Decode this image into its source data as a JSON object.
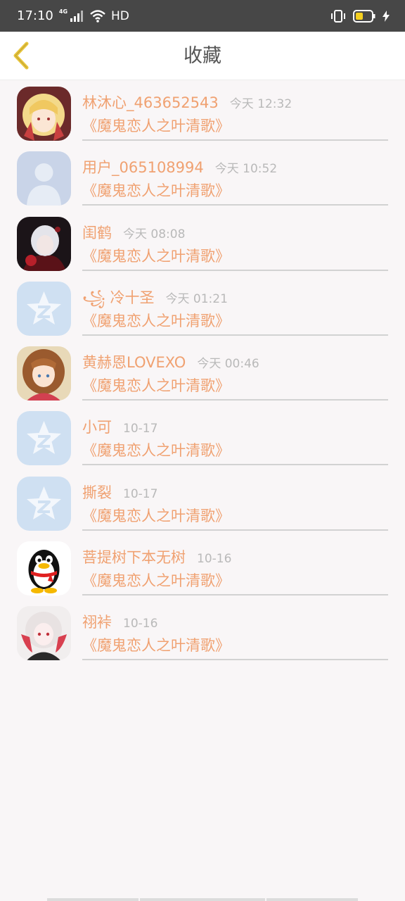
{
  "status_bar": {
    "time": "17:10",
    "network_type": "4G",
    "hd_label": "HD",
    "battery_color": "#f5d020"
  },
  "header": {
    "title": "收藏",
    "back_icon": "chevron-left-icon",
    "back_color": "#e8c53c"
  },
  "colors": {
    "accent": "#f0a171",
    "time_text": "#b9b9b9",
    "background": "#f9f6f7"
  },
  "favorites": [
    {
      "user": "林沐心_463652543",
      "time": "今天 12:32",
      "title": "《魔鬼恋人之叶清歌》",
      "avatar": "anime-blonde-avatar"
    },
    {
      "user": "用户_065108994",
      "time": "今天 10:52",
      "title": "《魔鬼恋人之叶清歌》",
      "avatar": "default-person-avatar"
    },
    {
      "user": "闺鹤",
      "time": "今天 08:08",
      "title": "《魔鬼恋人之叶清歌》",
      "avatar": "anime-white-hair-avatar"
    },
    {
      "user": "꧁ 冷十圣",
      "time": "今天 01:21",
      "title": "《魔鬼恋人之叶清歌》",
      "avatar": "qzone-star-avatar"
    },
    {
      "user": "黄赫恩LOVEXO",
      "time": "今天 00:46",
      "title": "《魔鬼恋人之叶清歌》",
      "avatar": "anime-brown-hair-avatar"
    },
    {
      "user": "小可",
      "time": "10-17",
      "title": "《魔鬼恋人之叶清歌》",
      "avatar": "qzone-star-avatar"
    },
    {
      "user": "撕裂",
      "time": "10-17",
      "title": "《魔鬼恋人之叶清歌》",
      "avatar": "qzone-star-avatar"
    },
    {
      "user": "菩提树下本无树",
      "time": "10-16",
      "title": "《魔鬼恋人之叶清歌》",
      "avatar": "qq-penguin-avatar"
    },
    {
      "user": "祤裃",
      "time": "10-16",
      "title": "《魔鬼恋人之叶清歌》",
      "avatar": "anime-pink-avatar"
    }
  ]
}
